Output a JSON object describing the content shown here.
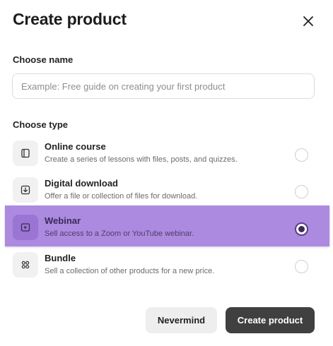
{
  "dialog": {
    "title": "Create product",
    "close_icon": "close-icon"
  },
  "name_section": {
    "label": "Choose name",
    "input_value": "",
    "placeholder": "Example: Free guide on creating your first product"
  },
  "type_section": {
    "label": "Choose type",
    "selected": "Webinar",
    "options": [
      {
        "title": "Online course",
        "description": "Create a series of lessons with files, posts, and quizzes.",
        "icon": "book-icon",
        "selected": false
      },
      {
        "title": "Digital download",
        "description": "Offer a file or collection of files for download.",
        "icon": "download-icon",
        "selected": false
      },
      {
        "title": "Webinar",
        "description": "Sell access to a Zoom or YouTube webinar.",
        "icon": "play-icon",
        "selected": true
      },
      {
        "title": "Bundle",
        "description": "Sell a collection of other products for a new price.",
        "icon": "grid-icon",
        "selected": false
      }
    ]
  },
  "footer": {
    "cancel_label": "Nevermind",
    "submit_label": "Create product"
  },
  "colors": {
    "highlight": "#9469d6",
    "primary_button": "#404040",
    "secondary_button": "#eeeeee"
  }
}
